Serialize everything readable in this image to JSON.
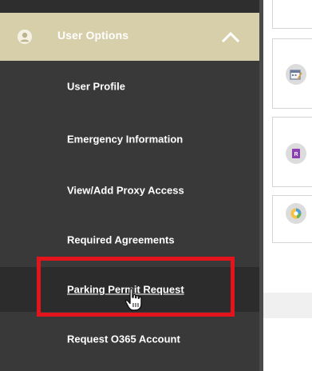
{
  "header": {
    "label": "User Options",
    "avatar_icon": "user-icon",
    "toggle_icon": "chevron-up-icon",
    "background": "#d7cfaa"
  },
  "menu": {
    "items": [
      {
        "label": "User Profile"
      },
      {
        "label": "Emergency Information"
      },
      {
        "label": "View/Add Proxy Access"
      },
      {
        "label": "Required Agreements"
      },
      {
        "label": "Parking Permit Request",
        "active": true
      },
      {
        "label": "Request O365 Account"
      }
    ]
  },
  "annotation": {
    "highlight_color": "#e3141b"
  },
  "right_panel": {
    "card_icons": [
      "calendar-icon",
      "form-icon",
      "pie-chart-icon"
    ]
  }
}
